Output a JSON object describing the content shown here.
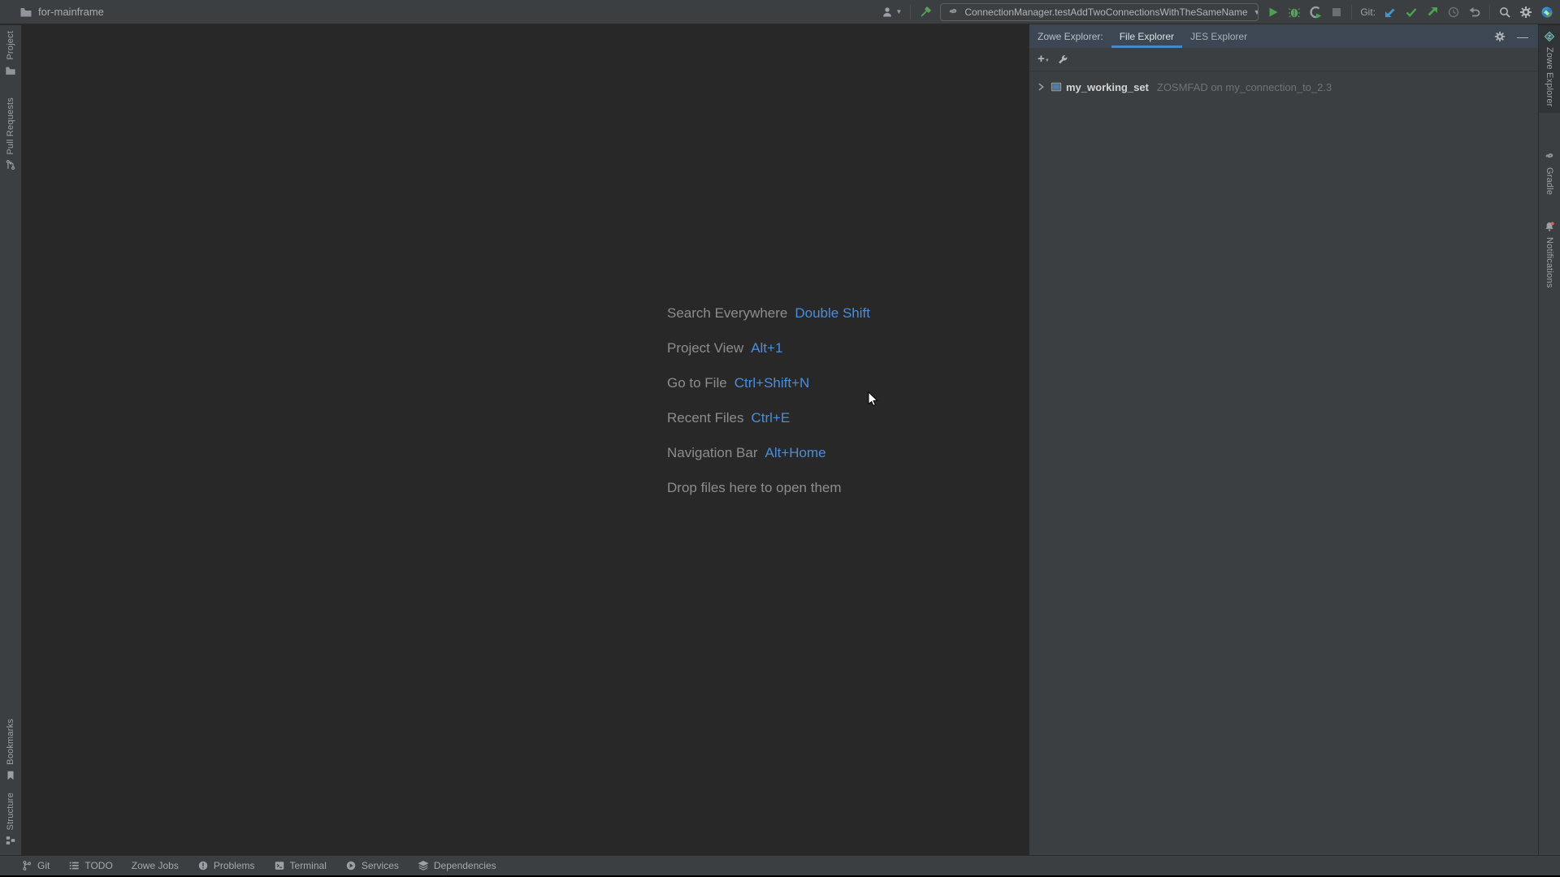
{
  "titlebar": {
    "project_name": "for-mainframe",
    "run_config": "ConnectionManager.testAddTwoConnectionsWithTheSameName",
    "git_label": "Git:"
  },
  "left_stripe": {
    "project": "Project",
    "pull_requests": "Pull Requests",
    "bookmarks": "Bookmarks",
    "structure": "Structure"
  },
  "right_stripe": {
    "zowe_explorer": "Zowe Explorer",
    "gradle": "Gradle",
    "notifications": "Notifications"
  },
  "editor_hints": {
    "rows": [
      {
        "label": "Search Everywhere",
        "shortcut": "Double Shift"
      },
      {
        "label": "Project View",
        "shortcut": "Alt+1"
      },
      {
        "label": "Go to File",
        "shortcut": "Ctrl+Shift+N"
      },
      {
        "label": "Recent Files",
        "shortcut": "Ctrl+E"
      },
      {
        "label": "Navigation Bar",
        "shortcut": "Alt+Home"
      },
      {
        "label": "Drop files here to open them",
        "shortcut": ""
      }
    ]
  },
  "zowe_panel": {
    "title": "Zowe Explorer:",
    "tabs": [
      {
        "label": "File Explorer",
        "active": true
      },
      {
        "label": "JES Explorer",
        "active": false
      }
    ],
    "tree": [
      {
        "name": "my_working_set",
        "detail": "ZOSMFAD on my_connection_to_2.3"
      }
    ]
  },
  "bottom_bar": [
    "Git",
    "TODO",
    "Zowe Jobs",
    "Problems",
    "Terminal",
    "Services",
    "Dependencies"
  ],
  "icons": [
    "folder-icon",
    "user-icon",
    "build-hammer-icon",
    "gradle-icon",
    "run-icon",
    "debug-icon",
    "coverage-icon",
    "stop-icon",
    "git-update-icon",
    "git-commit-icon",
    "git-push-icon",
    "history-icon",
    "rollback-icon",
    "search-icon",
    "gear-icon",
    "avatar-icon",
    "pull-request-icon",
    "bookmark-icon",
    "structure-icon",
    "zowe-icon",
    "bell-icon",
    "plus-icon",
    "wrench-icon",
    "chevron-right-icon",
    "working-set-icon",
    "minimize-icon",
    "git-branch-icon",
    "todo-list-icon",
    "problems-icon",
    "terminal-icon",
    "services-icon",
    "dependencies-icon",
    "cursor-pointer"
  ],
  "colors": {
    "panel_bg": "#3c3f41",
    "editor_bg": "#282828",
    "header_bg": "#3d4754",
    "accent_blue": "#4d8dd8",
    "tab_underline": "#4a88c5",
    "green": "#4da153",
    "icon_gray": "#9aa0a6"
  }
}
